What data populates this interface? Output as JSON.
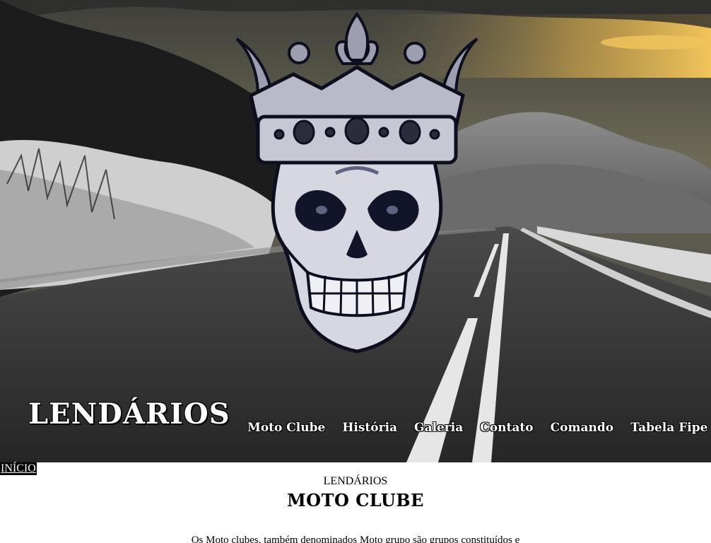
{
  "brand": {
    "title": "LENDÁRIOS"
  },
  "nav": {
    "items": [
      {
        "label": "Moto Clube"
      },
      {
        "label": "História"
      },
      {
        "label": "Galeria"
      },
      {
        "label": "Contato"
      },
      {
        "label": "Comando"
      },
      {
        "label": "Tabela Fipe"
      }
    ]
  },
  "inicio": {
    "label": "INÍCIO"
  },
  "section": {
    "eyebrow": "LENDÁRIOS",
    "title": "MOTO CLUBE",
    "intro": "Os Moto clubes, também denominados Moto grupo são grupos constituídos e organizados por pessoas que apreciam o motociclismo e motociclista. São"
  },
  "hero": {
    "background_image": "road-landscape-image",
    "logo_image": "crowned-skull-logo",
    "colors": {
      "sky": "#5a5a4a",
      "sunset": "#e8b84a",
      "road": "#2e2e2e",
      "lane_line": "#e6e6e6",
      "snow": "#d8d8d8"
    }
  },
  "colors": {
    "nav_text": "#ffffff",
    "inicio_bg": "#000000",
    "inicio_text": "#ffffff",
    "body_text": "#000000"
  }
}
